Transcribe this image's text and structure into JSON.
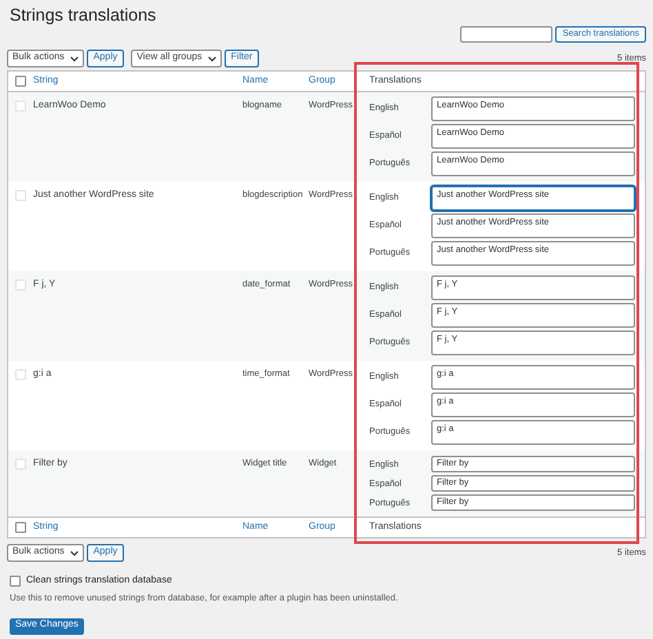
{
  "page_title": "Strings translations",
  "search": {
    "button": "Search translations"
  },
  "top_bar": {
    "bulk_actions": "Bulk actions",
    "apply": "Apply",
    "group_filter": "View all groups",
    "filter": "Filter",
    "count": "5 items"
  },
  "header": {
    "checked": false,
    "columns": [
      "String",
      "Name",
      "Group",
      "Translations"
    ]
  },
  "rows": [
    {
      "string": "LearnWoo Demo",
      "name": "blogname",
      "group": "WordPress",
      "checked": false,
      "kind": "textarea",
      "translations": [
        {
          "language": "English",
          "value": "LearnWoo Demo",
          "focused": false
        },
        {
          "language": "Español",
          "value": "LearnWoo Demo",
          "focused": false
        },
        {
          "language": "Português",
          "value": "LearnWoo Demo",
          "focused": false
        }
      ]
    },
    {
      "string": "Just another WordPress site",
      "name": "blogdescription",
      "group": "WordPress",
      "checked": false,
      "kind": "textarea",
      "translations": [
        {
          "language": "English",
          "value": "Just another WordPress site",
          "focused": true
        },
        {
          "language": "Español",
          "value": "Just another WordPress site",
          "focused": false
        },
        {
          "language": "Português",
          "value": "Just another WordPress site",
          "focused": false
        }
      ]
    },
    {
      "string": "F j, Y",
      "name": "date_format",
      "group": "WordPress",
      "checked": false,
      "kind": "textarea",
      "translations": [
        {
          "language": "English",
          "value": "F j, Y",
          "focused": false
        },
        {
          "language": "Español",
          "value": "F j, Y",
          "focused": false
        },
        {
          "language": "Português",
          "value": "F j, Y",
          "focused": false
        }
      ]
    },
    {
      "string": "g:i a",
      "name": "time_format",
      "group": "WordPress",
      "checked": false,
      "kind": "textarea",
      "translations": [
        {
          "language": "English",
          "value": "g:i a",
          "focused": false
        },
        {
          "language": "Español",
          "value": "g:i a",
          "focused": false
        },
        {
          "language": "Português",
          "value": "g:i a",
          "focused": false
        }
      ]
    },
    {
      "string": "Filter by",
      "name": "Widget title",
      "group": "Widget",
      "checked": false,
      "kind": "input",
      "translations": [
        {
          "language": "English",
          "value": "Filter by",
          "focused": false
        },
        {
          "language": "Español",
          "value": "Filter by",
          "focused": false
        },
        {
          "language": "Português",
          "value": "Filter by",
          "focused": false
        }
      ]
    }
  ],
  "footer": {
    "checked": false,
    "columns": [
      "String",
      "Name",
      "Group",
      "Translations"
    ]
  },
  "bottom_bar": {
    "bulk_actions": "Bulk actions",
    "apply": "Apply",
    "count": "5 items"
  },
  "clean": {
    "label": "Clean strings translation database",
    "checked": false,
    "description": "Use this to remove unused strings from database, for example after a plugin has been uninstalled."
  },
  "save": "Save Changes"
}
